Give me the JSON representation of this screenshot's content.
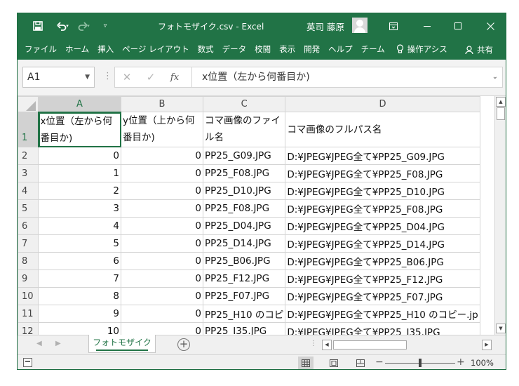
{
  "app": {
    "doc_title": "フォトモザイク.csv  -  Excel",
    "user_name": "英司 藤原"
  },
  "ribbon": {
    "tabs": [
      "ファイル",
      "ホーム",
      "挿入",
      "ページ レイアウト",
      "数式",
      "データ",
      "校閲",
      "表示",
      "開発",
      "ヘルプ",
      "チーム"
    ],
    "tell_me": "操作アシス",
    "share": "共有"
  },
  "formula_bar": {
    "name_box": "A1",
    "content": "x位置（左から何番目か)"
  },
  "grid": {
    "columns": [
      "A",
      "B",
      "C",
      "D"
    ],
    "header_row": {
      "row": "1",
      "a": "x位置（左から何番目か)",
      "b": "y位置（上から何番目か)",
      "c": "コマ画像のファイル名",
      "d": "コマ画像のフルパス名"
    },
    "rows": [
      {
        "row": "2",
        "a": "0",
        "b": "0",
        "c": "PP25_G09.JPG",
        "d": "D:¥JPEG¥JPEG全て¥PP25_G09.JPG"
      },
      {
        "row": "3",
        "a": "1",
        "b": "0",
        "c": "PP25_F08.JPG",
        "d": "D:¥JPEG¥JPEG全て¥PP25_F08.JPG"
      },
      {
        "row": "4",
        "a": "2",
        "b": "0",
        "c": "PP25_D10.JPG",
        "d": "D:¥JPEG¥JPEG全て¥PP25_D10.JPG"
      },
      {
        "row": "5",
        "a": "3",
        "b": "0",
        "c": "PP25_F08.JPG",
        "d": "D:¥JPEG¥JPEG全て¥PP25_F08.JPG"
      },
      {
        "row": "6",
        "a": "4",
        "b": "0",
        "c": "PP25_D04.JPG",
        "d": "D:¥JPEG¥JPEG全て¥PP25_D04.JPG"
      },
      {
        "row": "7",
        "a": "5",
        "b": "0",
        "c": "PP25_D14.JPG",
        "d": "D:¥JPEG¥JPEG全て¥PP25_D14.JPG"
      },
      {
        "row": "8",
        "a": "6",
        "b": "0",
        "c": "PP25_B06.JPG",
        "d": "D:¥JPEG¥JPEG全て¥PP25_B06.JPG"
      },
      {
        "row": "9",
        "a": "7",
        "b": "0",
        "c": "PP25_F12.JPG",
        "d": "D:¥JPEG¥JPEG全て¥PP25_F12.JPG"
      },
      {
        "row": "10",
        "a": "8",
        "b": "0",
        "c": "PP25_F07.JPG",
        "d": "D:¥JPEG¥JPEG全て¥PP25_F07.JPG"
      },
      {
        "row": "11",
        "a": "9",
        "b": "0",
        "c": "PP25_H10 のコピ",
        "d": "D:¥JPEG¥JPEG全て¥PP25_H10 のコピー.jp"
      },
      {
        "row": "12",
        "a": "10",
        "b": "0",
        "c": "PP25_I35.JPG",
        "d": "D:¥JPEG¥JPEG全て¥PP25_I35.JPG"
      }
    ]
  },
  "sheet_tabs": [
    "フォトモザイク"
  ],
  "status": {
    "zoom": "100%",
    "zoom_fraction": 0.5
  },
  "colors": {
    "accent": "#217346"
  }
}
